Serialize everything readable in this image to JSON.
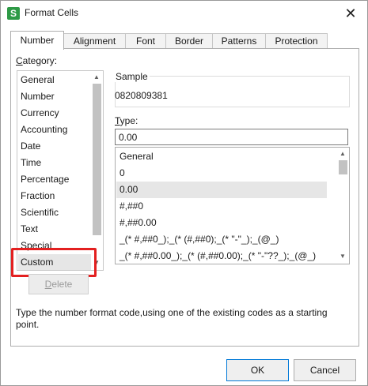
{
  "window": {
    "title": "Format Cells",
    "app_icon_letter": "S",
    "close_glyph": "✕"
  },
  "tabs": [
    {
      "label": "Number",
      "active": true
    },
    {
      "label": "Alignment"
    },
    {
      "label": "Font"
    },
    {
      "label": "Border"
    },
    {
      "label": "Patterns"
    },
    {
      "label": "Protection"
    }
  ],
  "category": {
    "label_first": "C",
    "label_rest": "ategory:",
    "items": [
      "General",
      "Number",
      "Currency",
      "Accounting",
      "Date",
      "Time",
      "Percentage",
      "Fraction",
      "Scientific",
      "Text",
      "Special",
      "Custom"
    ],
    "selected": "Custom"
  },
  "delete_button": {
    "label_first": "D",
    "label_rest": "elete"
  },
  "sample": {
    "label": "Sample",
    "value": "0820809381"
  },
  "type": {
    "label_first": "T",
    "label_rest": "ype:",
    "value": "0.00",
    "formats": [
      "General",
      "0",
      "0.00",
      "#,##0",
      "#,##0.00",
      "_(* #,##0_);_(* (#,##0);_(* \"-\"_);_(@_)",
      "_(* #,##0.00_);_(* (#,##0.00);_(* \"-\"??_);_(@_)"
    ],
    "selected": "0.00"
  },
  "description": "Type the number format code,using one of the existing codes as a starting point.",
  "buttons": {
    "ok": "OK",
    "cancel": "Cancel"
  }
}
